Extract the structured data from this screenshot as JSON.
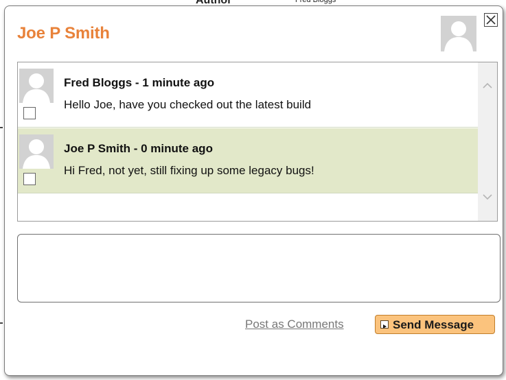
{
  "background": {
    "fragment_left": "Author",
    "fragment_right": "Fred Bloggs"
  },
  "dialog": {
    "title": "Joe P Smith",
    "close_icon": "close-icon"
  },
  "messages": [
    {
      "header": "Fred Bloggs - 1 minute ago",
      "text": "Hello Joe, have you checked out the latest build",
      "checked": false
    },
    {
      "header": "Joe P Smith - 0 minute ago",
      "text": "Hi Fred, not yet, still fixing up some legacy bugs!",
      "checked": false
    }
  ],
  "compose": {
    "value": "",
    "placeholder": ""
  },
  "actions": {
    "post_comments_label": "Post as Comments",
    "send_label": "Send Message"
  },
  "colors": {
    "title": "#e8823a",
    "highlight_row": "#e2e8c9",
    "send_button": "#fbc37d"
  }
}
